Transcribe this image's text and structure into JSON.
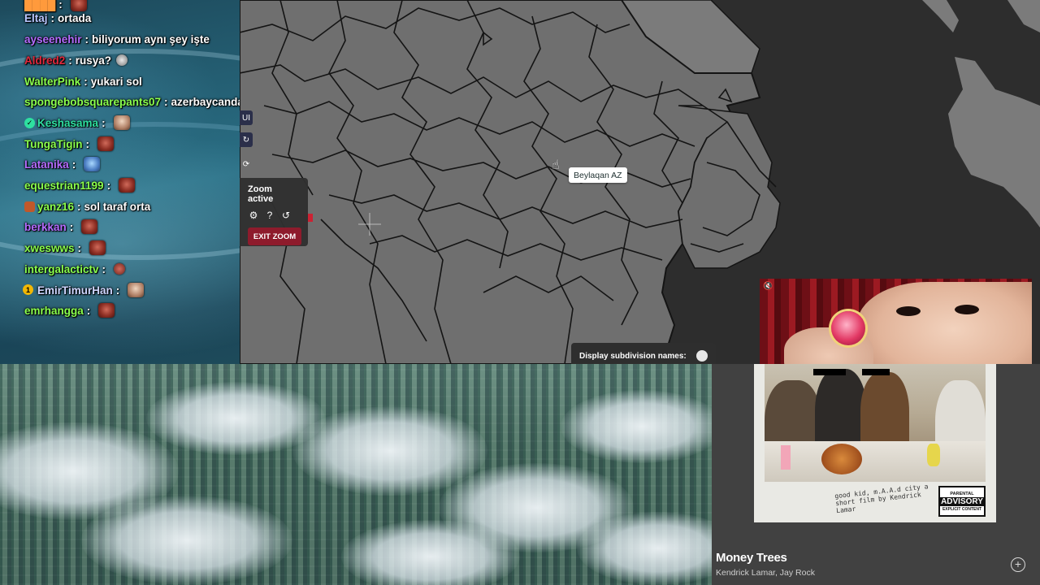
{
  "chat": {
    "messages": [
      {
        "user": "Eltaj",
        "message": "ortada",
        "color": "#b9c7ff"
      },
      {
        "user": "ayseenehir",
        "message": "biliyorum aynı şey işte",
        "color": "#b56cff"
      },
      {
        "user": "Aldred2",
        "message": "rusya?",
        "color": "#e0283c"
      },
      {
        "user": "WalterPink",
        "message": "yukari sol",
        "color": "#8aff4d"
      },
      {
        "user": "spongebobsquarepants07",
        "message": "azerbaycanda gencenin adı syunik",
        "color": "#8aff4d"
      },
      {
        "user": "Keshasama",
        "message": "",
        "color": "#2ee0a0"
      },
      {
        "user": "TungaTigin",
        "message": "",
        "color": "#8aff4d"
      },
      {
        "user": "Latanika",
        "message": "",
        "color": "#b56cff"
      },
      {
        "user": "equestrian1199",
        "message": "",
        "color": "#8aff4d"
      },
      {
        "user": "yanz16",
        "message": "sol taraf orta",
        "color": "#8aff4d"
      },
      {
        "user": "berkkan",
        "message": "",
        "color": "#b56cff"
      },
      {
        "user": "xweswws",
        "message": "",
        "color": "#8aff4d"
      },
      {
        "user": "intergalactictv",
        "message": "",
        "color": "#8aff4d"
      },
      {
        "user": "EmirTimurHan",
        "message": "",
        "color": "#cfd6ff"
      },
      {
        "user": "emrhangga",
        "message": "",
        "color": "#8aff4d"
      }
    ]
  },
  "map": {
    "side_buttons": [
      "UI",
      "↻",
      "⟳"
    ],
    "zoom_box": {
      "title": "Zoom active",
      "exit_label": "EXIT ZOOM"
    },
    "tooltip": "Beylaqan AZ",
    "subdivision_label": "Display subdivision names:",
    "subdivision_toggle_on": false,
    "colors": {
      "land": "#6f6f6f",
      "background": "#2d2d2d",
      "outside": "#7b7b7b",
      "borders": "#141414"
    }
  },
  "video": {
    "mute_icon": "speaker-muted-icon"
  },
  "spotify": {
    "song_title": "Money Trees",
    "artist": "Kendrick Lamar, Jay Rock",
    "album_caption": "good kid, m.A.A.d city a short film by Kendrick Lamar",
    "advisory_top": "PARENTAL",
    "advisory_main": "ADVISORY",
    "advisory_bottom": "EXPLICIT CONTENT",
    "add_icon": "plus-circle-icon"
  }
}
